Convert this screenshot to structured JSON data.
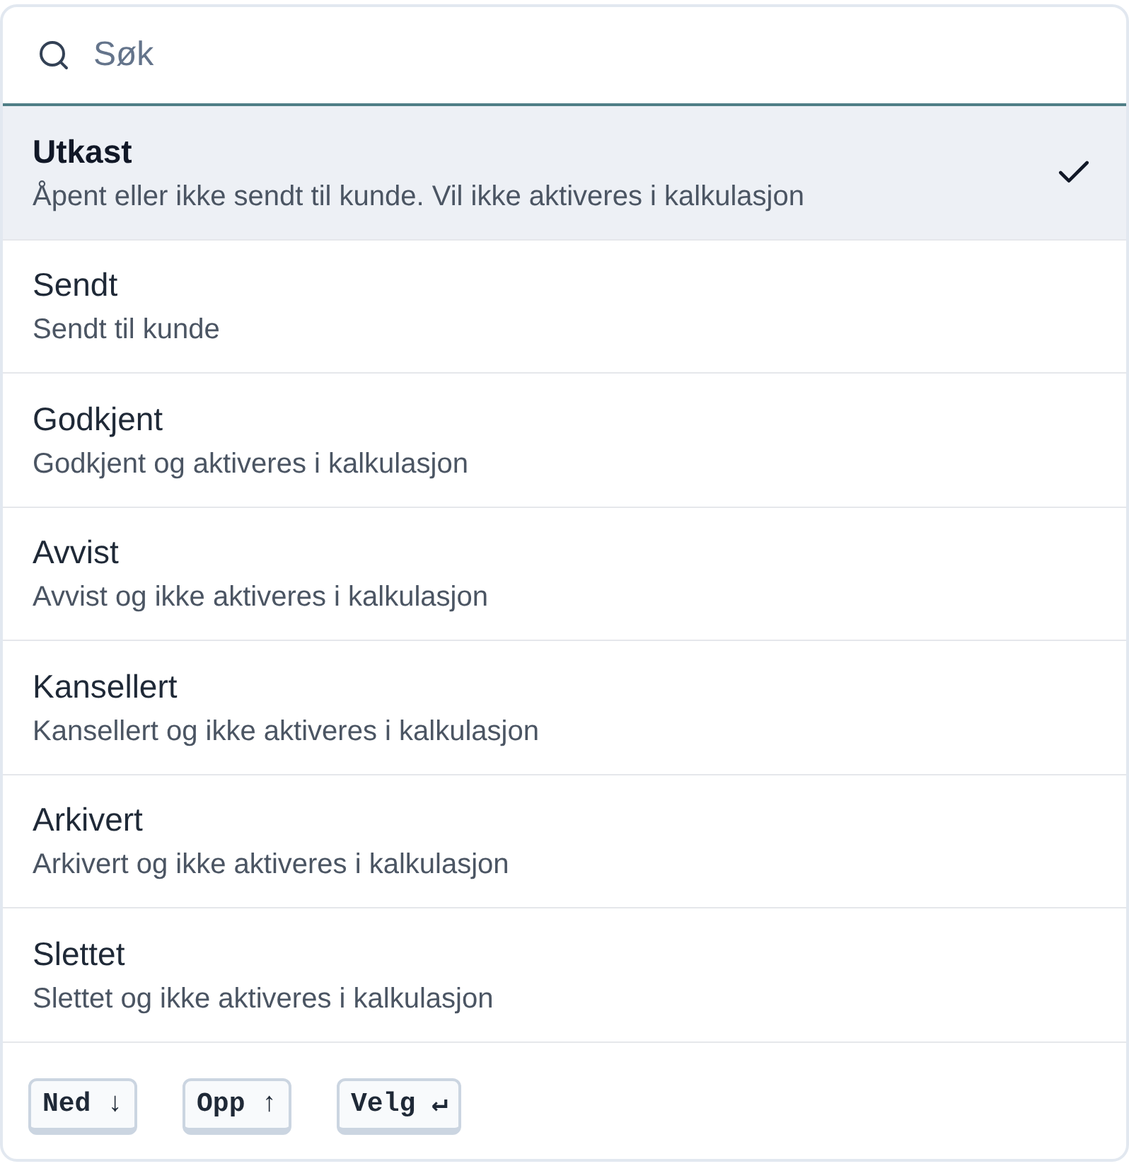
{
  "search": {
    "placeholder": "Søk"
  },
  "options": [
    {
      "title": "Utkast",
      "description": "Åpent eller ikke sendt til kunde. Vil ikke aktiveres i kalkulasjon",
      "selected": true
    },
    {
      "title": "Sendt",
      "description": "Sendt til kunde",
      "selected": false
    },
    {
      "title": "Godkjent",
      "description": "Godkjent og aktiveres i kalkulasjon",
      "selected": false
    },
    {
      "title": "Avvist",
      "description": "Avvist og ikke aktiveres i kalkulasjon",
      "selected": false
    },
    {
      "title": "Kansellert",
      "description": "Kansellert og ikke aktiveres i kalkulasjon",
      "selected": false
    },
    {
      "title": "Arkivert",
      "description": "Arkivert og ikke aktiveres i kalkulasjon",
      "selected": false
    },
    {
      "title": "Slettet",
      "description": "Slettet og ikke aktiveres i kalkulasjon",
      "selected": false
    }
  ],
  "shortcuts": [
    "Ned ↓",
    "Opp ↑",
    "Velg ↵"
  ]
}
